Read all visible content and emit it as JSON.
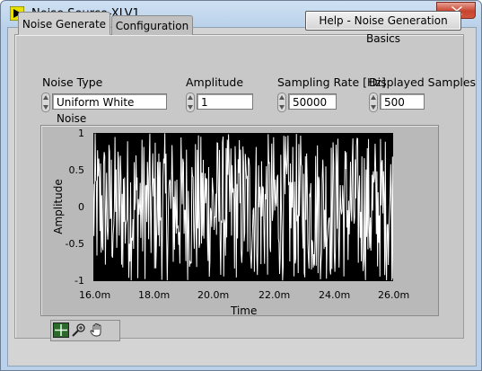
{
  "window": {
    "title": "Noise Source-XLV1"
  },
  "tabs": [
    {
      "label": "Noise Generate",
      "active": true
    },
    {
      "label": "Configuration",
      "active": false
    }
  ],
  "help_button": {
    "label": "Help - Noise Generation Basics"
  },
  "controls": {
    "noise_type": {
      "label": "Noise Type",
      "value": "Uniform White Noise"
    },
    "amplitude": {
      "label": "Amplitude",
      "value": "1"
    },
    "sampling_rate": {
      "label": "Sampling Rate [Hz]",
      "value": "50000"
    },
    "displayed_samples": {
      "label": "Displayed Samples",
      "value": "500"
    }
  },
  "chart_data": {
    "type": "line",
    "xlabel": "Time",
    "ylabel": "Amplitude",
    "x_ticks": [
      "16.0m",
      "18.0m",
      "20.0m",
      "22.0m",
      "24.0m",
      "26.0m"
    ],
    "y_ticks": [
      "1",
      "0.5",
      "0",
      "-0.5",
      "-1"
    ],
    "xlim": [
      0.016,
      0.026
    ],
    "ylim": [
      -1,
      1
    ],
    "grid": false,
    "series": [
      {
        "color": "#ffffff",
        "samples": 500,
        "distribution": "uniform",
        "min": -1,
        "max": 1
      }
    ]
  },
  "palette_icons": [
    "crosshair-icon",
    "zoom-icon",
    "pan-hand-icon"
  ]
}
